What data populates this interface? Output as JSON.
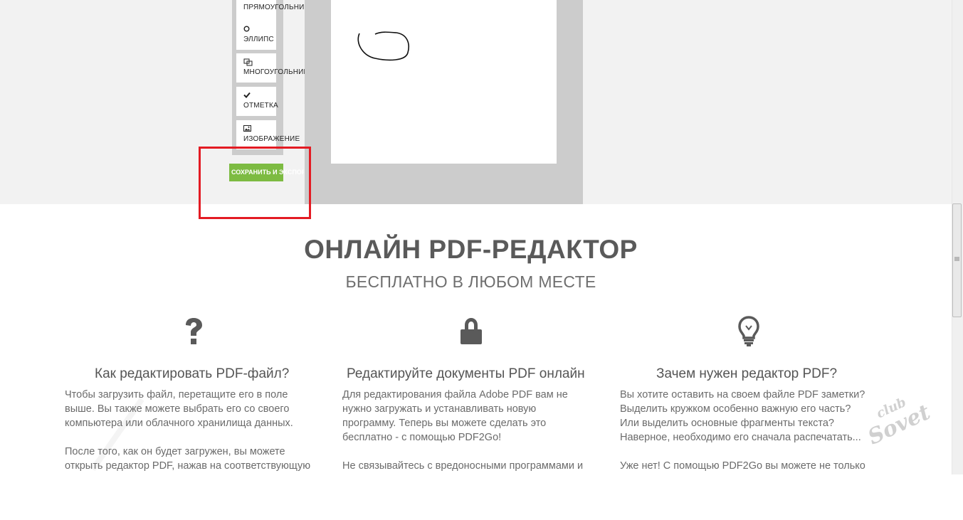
{
  "toolbar": {
    "tools": [
      {
        "label": "ПРЯМОУГОЛЬНИК",
        "icon": "rectangle-icon"
      },
      {
        "label": "ЭЛЛИПС",
        "icon": "ellipse-icon"
      },
      {
        "label": "МНОГОУГОЛЬНИК",
        "icon": "polygon-icon"
      },
      {
        "label": "ОТМЕТКА",
        "icon": "checkmark-icon"
      },
      {
        "label": "ИЗОБРАЖЕНИЕ",
        "icon": "image-icon"
      }
    ],
    "save_label": "СОХРАНИТЬ И ЭКСПОРТ"
  },
  "hero": {
    "title": "ОНЛАЙН PDF-РЕДАКТОР",
    "subtitle": "БЕСПЛАТНО В ЛЮБОМ МЕСТЕ"
  },
  "columns": [
    {
      "icon": "question-icon",
      "heading": "Как редактировать PDF-файл?",
      "text": "Чтобы загрузить файл, перетащите его в поле\nвыше. Вы также можете выбрать его со своего\nкомпьютера или облачного хранилища данных.\n\nПосле того, как он будет загружен, вы можете\nоткрыть редактор PDF, нажав на соответствующую"
    },
    {
      "icon": "lock-icon",
      "heading": "Редактируйте документы PDF онлайн",
      "text": "Для редактирования файла Adobe PDF вам не\nнужно загружать и устанавливать новую\nпрограмму. Теперь вы можете сделать это\nбесплатно - с помощью PDF2Go!\n\nНе связывайтесь с вредоносными программами и"
    },
    {
      "icon": "lightbulb-icon",
      "heading": "Зачем нужен редактор PDF?",
      "text": "Вы хотите оставить на своем файле PDF заметки?\nВыделить кружком особенно важную его часть?\nИли выделить основные фрагменты текста?\nНаверное, необходимо его сначала распечатать...\n\nУже нет! С помощью PDF2Go вы можете не только"
    }
  ],
  "watermark": {
    "line1": "club",
    "line2": "Sovet"
  },
  "colors": {
    "accent_green": "#7dbb42",
    "highlight_red": "#e31b23",
    "heading_gray": "#5a5a5a"
  }
}
